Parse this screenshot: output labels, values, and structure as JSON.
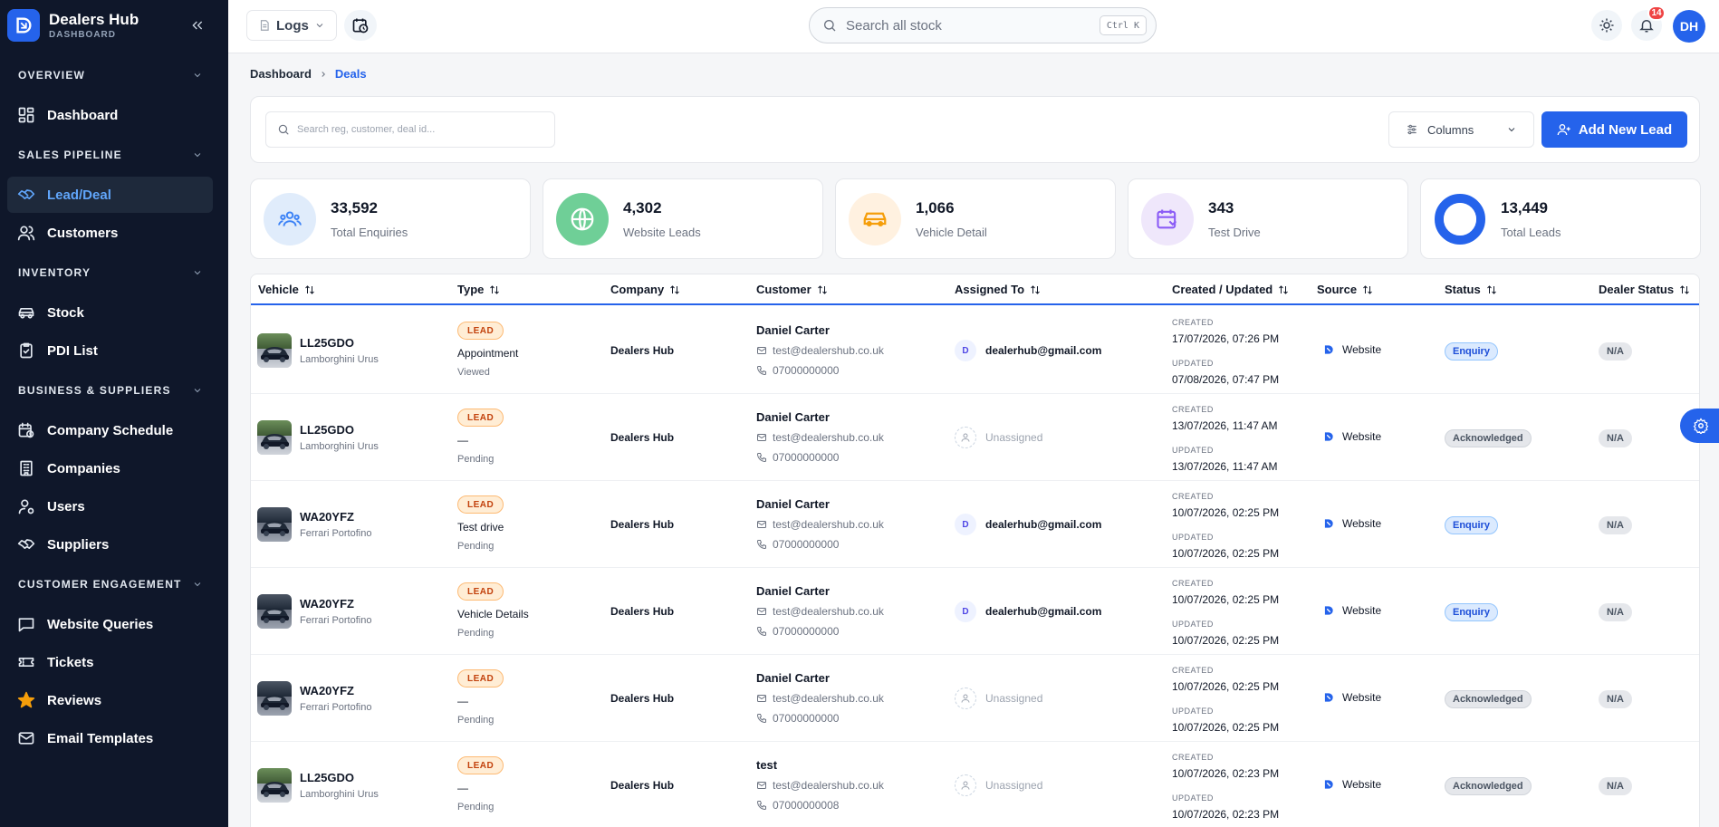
{
  "brand": {
    "name": "Dealers Hub",
    "sub": "DASHBOARD"
  },
  "sidebar": {
    "sections": [
      {
        "title": "OVERVIEW",
        "items": [
          {
            "label": "Dashboard",
            "icon": "dashboard-grid-icon"
          }
        ]
      },
      {
        "title": "SALES PIPELINE",
        "items": [
          {
            "label": "Lead/Deal",
            "icon": "handshake-icon",
            "active": true
          },
          {
            "label": "Customers",
            "icon": "users-icon"
          }
        ]
      },
      {
        "title": "INVENTORY",
        "items": [
          {
            "label": "Stock",
            "icon": "car-icon"
          },
          {
            "label": "PDI List",
            "icon": "clipboard-check-icon"
          }
        ]
      },
      {
        "title": "BUSINESS & SUPPLIERS",
        "items": [
          {
            "label": "Company Schedule",
            "icon": "calendar-clock-icon"
          },
          {
            "label": "Companies",
            "icon": "building-icon"
          },
          {
            "label": "Users",
            "icon": "user-cog-icon"
          },
          {
            "label": "Suppliers",
            "icon": "handshake-icon"
          }
        ]
      },
      {
        "title": "CUSTOMER ENGAGEMENT",
        "items": [
          {
            "label": "Website Queries",
            "icon": "message-square-icon"
          },
          {
            "label": "Tickets",
            "icon": "ticket-icon"
          },
          {
            "label": "Reviews",
            "icon": "star-icon"
          },
          {
            "label": "Email Templates",
            "icon": "mail-icon"
          }
        ]
      }
    ]
  },
  "topbar": {
    "logs_label": "Logs",
    "search_placeholder": "Search all stock",
    "shortcut": "Ctrl K",
    "notification_count": "14",
    "avatar_initials": "DH"
  },
  "breadcrumb": {
    "root": "Dashboard",
    "current": "Deals"
  },
  "filters": {
    "search_placeholder": "Search reg, customer, deal id...",
    "columns_label": "Columns",
    "add_label": "Add New Lead"
  },
  "stats": [
    {
      "value": "33,592",
      "label": "Total Enquiries",
      "icon": "users-group-icon",
      "bg": "#e0ecfb",
      "fg": "#3b82f6"
    },
    {
      "value": "4,302",
      "label": "Website Leads",
      "icon": "globe-icon",
      "bg": "#6fcf97",
      "fg": "#ffffff"
    },
    {
      "value": "1,066",
      "label": "Vehicle Detail",
      "icon": "car-icon",
      "bg": "#fff1e0",
      "fg": "#f59e0b"
    },
    {
      "value": "343",
      "label": "Test Drive",
      "icon": "calendar-sync-icon",
      "bg": "#efe7fb",
      "fg": "#8b5cf6"
    },
    {
      "value": "13,449",
      "label": "Total Leads",
      "icon": "ring-icon",
      "bg": "#2563eb",
      "fg": "#ffffff"
    }
  ],
  "table": {
    "headers": [
      "Vehicle",
      "Type",
      "Company",
      "Customer",
      "Assigned To",
      "Created / Updated",
      "Source",
      "Status",
      "Dealer Status"
    ],
    "created_label": "CREATED",
    "updated_label": "UPDATED",
    "rows": [
      {
        "reg": "LL25GDO",
        "model": "Lamborghini Urus",
        "badge": "LEAD",
        "type": "Appointment",
        "type_status": "Viewed",
        "company": "Dealers Hub",
        "customer": "Daniel Carter",
        "email": "test@dealershub.co.uk",
        "phone": "07000000000",
        "assigned": "dealerhub@gmail.com",
        "assigned_initial": "D",
        "created": "17/07/2026, 07:26 PM",
        "updated": "07/08/2026, 07:47 PM",
        "source": "Website",
        "status": "Enquiry",
        "dealer_status": "N/A",
        "car": "green"
      },
      {
        "reg": "LL25GDO",
        "model": "Lamborghini Urus",
        "badge": "LEAD",
        "type": "—",
        "type_status": "Pending",
        "company": "Dealers Hub",
        "customer": "Daniel Carter",
        "email": "test@dealershub.co.uk",
        "phone": "07000000000",
        "assigned": "Unassigned",
        "assigned_initial": "",
        "created": "13/07/2026, 11:47 AM",
        "updated": "13/07/2026, 11:47 AM",
        "source": "Website",
        "status": "Acknowledged",
        "dealer_status": "N/A",
        "car": "green"
      },
      {
        "reg": "WA20YFZ",
        "model": "Ferrari Portofino",
        "badge": "LEAD",
        "type": "Test drive",
        "type_status": "Pending",
        "company": "Dealers Hub",
        "customer": "Daniel Carter",
        "email": "test@dealershub.co.uk",
        "phone": "07000000000",
        "assigned": "dealerhub@gmail.com",
        "assigned_initial": "D",
        "created": "10/07/2026, 02:25 PM",
        "updated": "10/07/2026, 02:25 PM",
        "source": "Website",
        "status": "Enquiry",
        "dealer_status": "N/A",
        "car": "dark"
      },
      {
        "reg": "WA20YFZ",
        "model": "Ferrari Portofino",
        "badge": "LEAD",
        "type": "Vehicle Details",
        "type_status": "Pending",
        "company": "Dealers Hub",
        "customer": "Daniel Carter",
        "email": "test@dealershub.co.uk",
        "phone": "07000000000",
        "assigned": "dealerhub@gmail.com",
        "assigned_initial": "D",
        "created": "10/07/2026, 02:25 PM",
        "updated": "10/07/2026, 02:25 PM",
        "source": "Website",
        "status": "Enquiry",
        "dealer_status": "N/A",
        "car": "dark"
      },
      {
        "reg": "WA20YFZ",
        "model": "Ferrari Portofino",
        "badge": "LEAD",
        "type": "—",
        "type_status": "Pending",
        "company": "Dealers Hub",
        "customer": "Daniel Carter",
        "email": "test@dealershub.co.uk",
        "phone": "07000000000",
        "assigned": "Unassigned",
        "assigned_initial": "",
        "created": "10/07/2026, 02:25 PM",
        "updated": "10/07/2026, 02:25 PM",
        "source": "Website",
        "status": "Acknowledged",
        "dealer_status": "N/A",
        "car": "dark"
      },
      {
        "reg": "LL25GDO",
        "model": "Lamborghini Urus",
        "badge": "LEAD",
        "type": "—",
        "type_status": "Pending",
        "company": "Dealers Hub",
        "customer": "test",
        "email": "test@dealershub.co.uk",
        "phone": "07000000008",
        "assigned": "Unassigned",
        "assigned_initial": "",
        "created": "10/07/2026, 02:23 PM",
        "updated": "10/07/2026, 02:23 PM",
        "source": "Website",
        "status": "Acknowledged",
        "dealer_status": "N/A",
        "car": "green"
      }
    ]
  }
}
